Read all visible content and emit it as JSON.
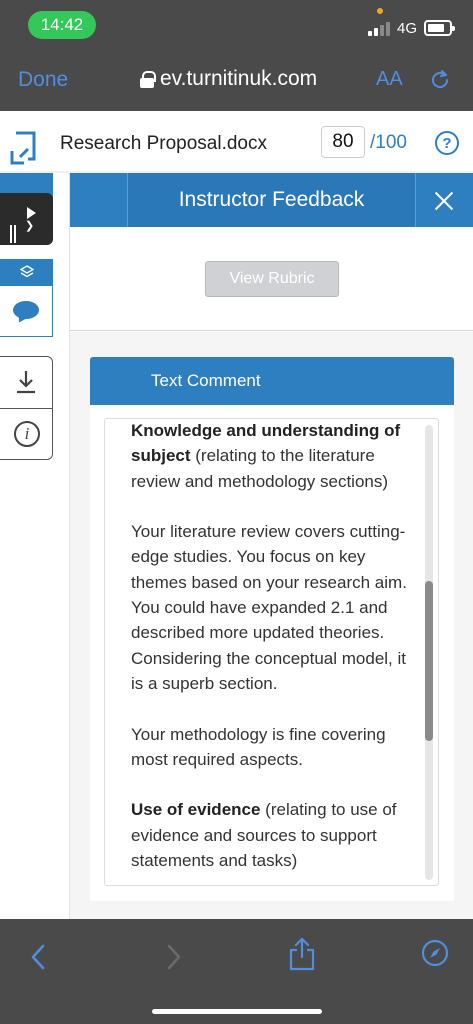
{
  "status_bar": {
    "time": "14:42",
    "network": "4G"
  },
  "browser": {
    "done_label": "Done",
    "url": "ev.turnitinuk.com",
    "text_size_label": "AA"
  },
  "header": {
    "doc_title": "Research Proposal.docx",
    "score": "80",
    "score_total": "/100",
    "help_label": "?"
  },
  "feedback": {
    "title": "Instructor Feedback",
    "view_rubric": "View Rubric",
    "comment_header": "Text Comment",
    "comment": {
      "p1_bold": "Knowledge and understanding of subject",
      "p1_rest": " (relating to the literature review and methodology sections)",
      "p2": " Your literature review covers cutting-edge studies. You focus on key themes based on your research aim. You could have expanded 2.1 and described more updated theories. Considering the conceptual model, it is a superb section.",
      "p3": "Your methodology is fine covering most required aspects.",
      "p4_bold": "Use of evidence",
      "p4_rest": " (relating to use of evidence and sources to support statements and tasks)"
    }
  },
  "colors": {
    "accent": "#2e7fc0",
    "browser_chrome": "#4a4a4a",
    "ios_link": "#4f8fe0",
    "status_green": "#34c759"
  }
}
